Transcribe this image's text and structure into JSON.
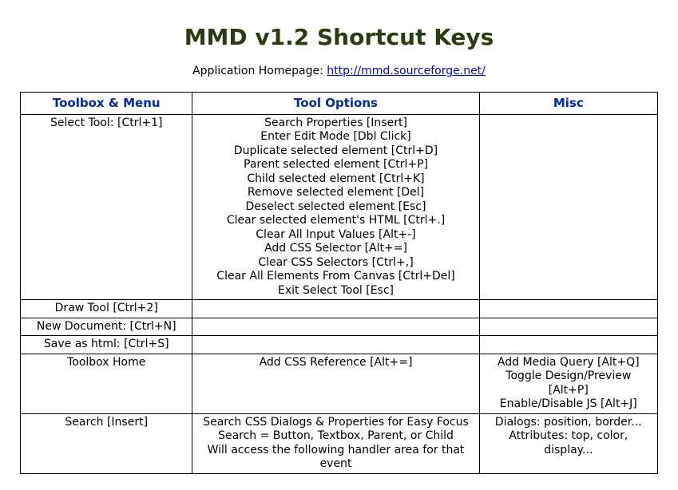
{
  "title": "MMD v1.2 Shortcut Keys",
  "homepage_label": "Application Homepage: ",
  "homepage_url": "http://mmd.sourceforge.net/",
  "headers": {
    "col1": "Toolbox & Menu",
    "col2": "Tool Options",
    "col3": "Misc"
  },
  "rows": {
    "r1": {
      "c1": "Select Tool: [Ctrl+1]",
      "c2": {
        "l1": "Search Properties [Insert]",
        "l2": "Enter Edit Mode [Dbl Click]",
        "l3": "Duplicate selected element [Ctrl+D]",
        "l4": "Parent selected element [Ctrl+P]",
        "l5": "Child selected element [Ctrl+K]",
        "l6": "Remove selected element [Del]",
        "l7": "Deselect selected element [Esc]",
        "l8": "Clear selected element's HTML [Ctrl+.]",
        "l9": "Clear All Input Values [Alt+-]",
        "l10": "Add CSS Selector [Alt+=]",
        "l11": "Clear CSS Selectors [Ctrl+,]",
        "l12": "Clear All Elements From Canvas [Ctrl+Del]",
        "l13": "Exit Select Tool [Esc]"
      },
      "c3": ""
    },
    "r2": {
      "c1": "Draw Tool [Ctrl+2]",
      "c2": "",
      "c3": ""
    },
    "r3": {
      "c1": "New Document: [Ctrl+N]",
      "c2": "",
      "c3": ""
    },
    "r4": {
      "c1": "Save as html: [Ctrl+S]",
      "c2": "",
      "c3": ""
    },
    "r5": {
      "c1": "Toolbox Home",
      "c2": "Add CSS Reference [Alt+=]",
      "c3": {
        "l1": "Add Media Query [Alt+Q]",
        "l2": "Toggle Design/Preview [Alt+P]",
        "l3": "Enable/Disable JS [Alt+J]"
      }
    },
    "r6": {
      "c1": "Search [Insert]",
      "c2": {
        "l1": "Search CSS Dialogs & Properties for Easy Focus",
        "l2": "Search = Button, Textbox, Parent, or Child",
        "l3": "Will access the following handler area for that event"
      },
      "c3": {
        "l1": "Dialogs: position, border...",
        "l2": "Attributes: top, color, display..."
      }
    }
  }
}
